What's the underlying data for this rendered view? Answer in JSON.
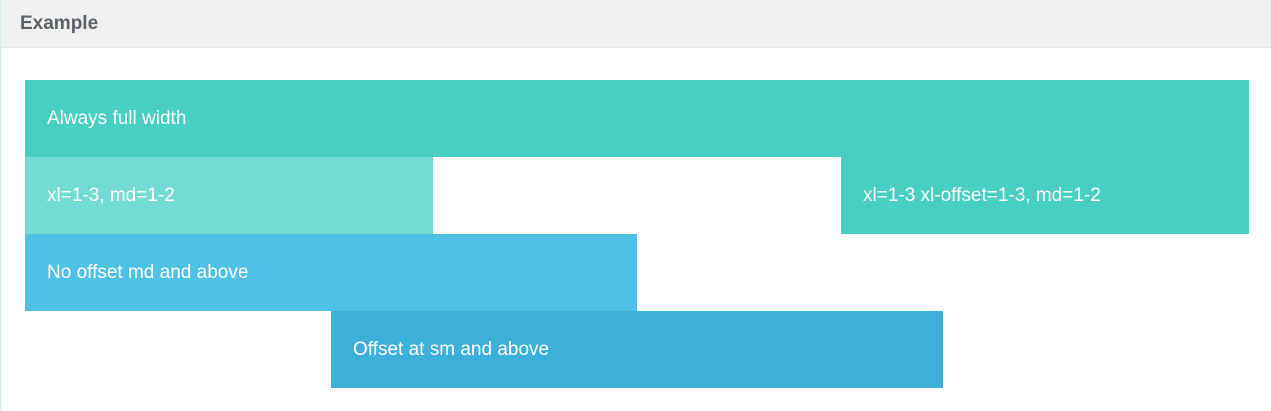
{
  "panel": {
    "title": "Example"
  },
  "grid": {
    "row1": {
      "label": "Always full width"
    },
    "row2": {
      "left_label": "xl=1-3, md=1-2",
      "right_label": "xl=1-3 xl-offset=1-3, md=1-2"
    },
    "row3": {
      "label": "No offset md and above"
    },
    "row4": {
      "label": "Offset at sm and above"
    }
  },
  "colors": {
    "header_bg": "#f0f0f0",
    "title_text": "#5b6266",
    "teal": "#48cfc1",
    "teal_light": "#72dbd2",
    "blue": "#4fc1e7",
    "blue_dark": "#3cb0da"
  }
}
